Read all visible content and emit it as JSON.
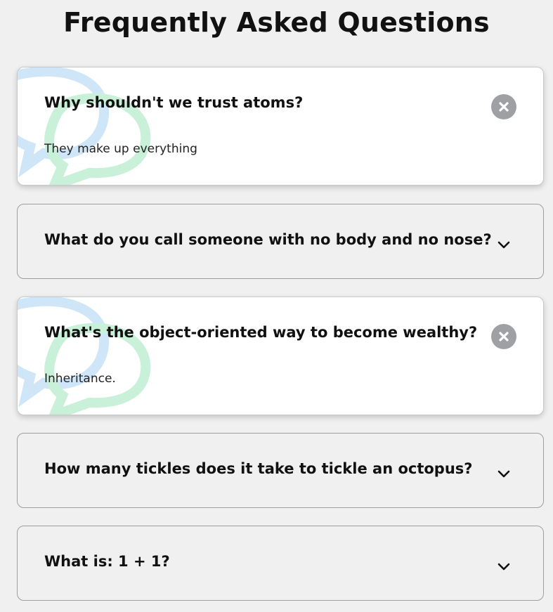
{
  "page": {
    "title": "Frequently Asked Questions"
  },
  "faqs": [
    {
      "question": "Why shouldn't we trust atoms?",
      "answer": "They make up everything",
      "expanded": true
    },
    {
      "question": "What do you call someone with no body and no nose?",
      "answer": "",
      "expanded": false
    },
    {
      "question": "What's the object-oriented way to become wealthy?",
      "answer": "Inheritance.",
      "expanded": true
    },
    {
      "question": "How many tickles does it take to tickle an octopus?",
      "answer": "",
      "expanded": false
    },
    {
      "question": "What is: 1 + 1?",
      "answer": "",
      "expanded": false
    }
  ],
  "icons": {
    "expanded_toggle": "close-icon",
    "collapsed_toggle": "chevron-down-icon",
    "decoration": "chat-bubbles-icon"
  },
  "colors": {
    "background": "#f0f0f0",
    "card_open": "#ffffff",
    "close_circle": "#9ea0a3",
    "bubble_blue": "#cfe6f8",
    "bubble_green": "#c9f0d8"
  }
}
